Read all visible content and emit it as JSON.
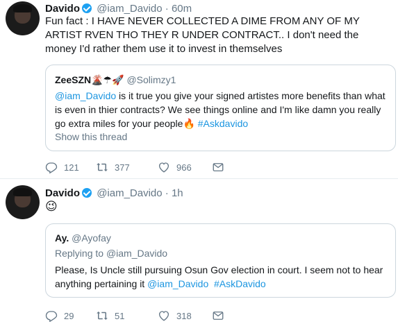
{
  "tweets": [
    {
      "name": "Davido",
      "handle": "@iam_Davido",
      "dot": "·",
      "time": "60m",
      "text": "Fun fact : I HAVE NEVER COLLECTED A DIME FROM ANY OF MY ARTIST RVEN THO THEY R UNDER CONTRACT.. I don't need the money I'd rather them use it to invest in themselves",
      "quote": {
        "name": "ZeeSZN",
        "name_emojis": "🌋☂🚀",
        "handle": "@Solimzy1",
        "mention": "@iam_Davido",
        "text": " is it true you give your signed artistes more benefits than what is even in thier contracts? We see things online and I'm like damn you really go extra miles for your people",
        "emoji": "🔥",
        "hashtag": " #Askdavido",
        "show_thread": "Show this thread"
      },
      "replies": "121",
      "retweets": "377",
      "likes": "966"
    },
    {
      "name": "Davido",
      "handle": "@iam_Davido",
      "dot": "·",
      "time": "1h",
      "text": "😉",
      "quote": {
        "name": "Ay.",
        "handle": "@Ayofay",
        "replying_prefix": "Replying to ",
        "replying_to": "@iam_Davido",
        "text": "Please, Is Uncle still pursuing Osun Gov election in court. I seem not to hear anything pertaining it ",
        "mention": "@iam_Davido",
        "hashtag": "  #AskDavido"
      },
      "replies": "29",
      "retweets": "51",
      "likes": "318"
    }
  ],
  "colors": {
    "text": "#14171a",
    "secondary": "#657786",
    "link": "#1b95e0",
    "verified": "#1da1f2",
    "border": "#ccd6dd",
    "divider": "#e6ecf0"
  },
  "icons": [
    "verified-badge-icon",
    "reply-icon",
    "retweet-icon",
    "like-icon",
    "message-icon"
  ]
}
